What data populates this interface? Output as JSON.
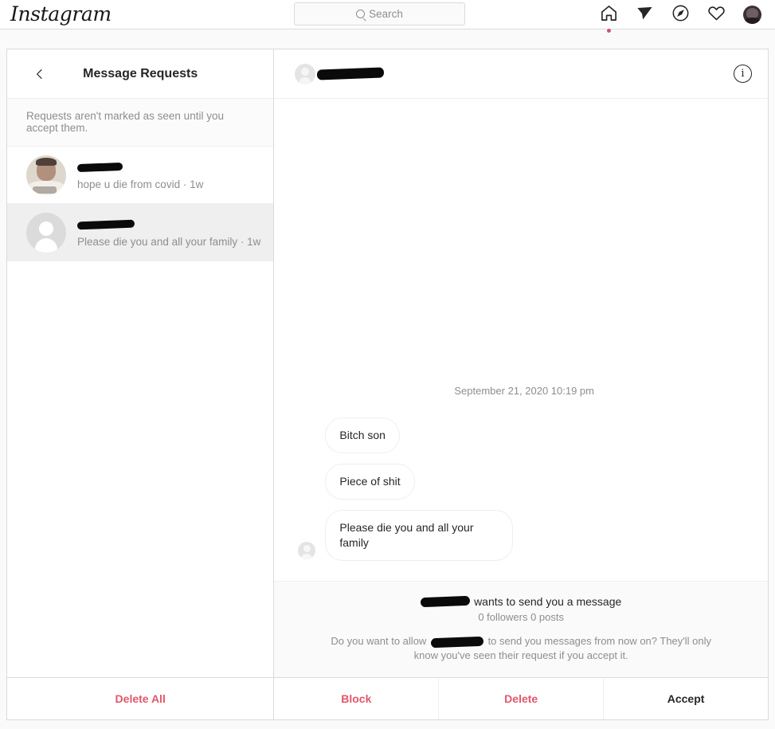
{
  "app": {
    "brand": "Instagram",
    "accent_red": "#e2576b",
    "text_primary": "#262626",
    "text_secondary": "#8e8e8e"
  },
  "topnav": {
    "search": {
      "placeholder": "Search",
      "value": "",
      "icon": "search-icon"
    },
    "icons": [
      {
        "name": "home-icon",
        "has_badge": true,
        "badge_color": "#c9566a"
      },
      {
        "name": "direct-paper-plane-icon",
        "has_badge": false
      },
      {
        "name": "explore-compass-icon",
        "has_badge": false
      },
      {
        "name": "activity-heart-icon",
        "has_badge": false
      },
      {
        "name": "profile-avatar",
        "has_badge": false
      }
    ]
  },
  "sidebar": {
    "back_icon": "chevron-left-icon",
    "title": "Message Requests",
    "notice": "Requests aren't marked as seen until you accept them.",
    "requests": [
      {
        "name_redacted": true,
        "name_bar_width": 57,
        "avatar_type": "photo",
        "preview": "hope u die from covid · 1w",
        "selected": false
      },
      {
        "name_redacted": true,
        "name_bar_width": 72,
        "avatar_type": "default",
        "preview": "Please die you and all your family · 1w",
        "selected": true
      }
    ],
    "delete_all_label": "Delete All"
  },
  "conversation": {
    "header": {
      "name_redacted": true,
      "name_bar_width": 84,
      "avatar_type": "default",
      "info_icon": "info-circle-icon",
      "info_glyph": "i"
    },
    "date_separator": "September 21, 2020 10:19 pm",
    "messages": [
      {
        "text": "Bitch son",
        "from": "them",
        "show_avatar": false
      },
      {
        "text": "Piece of shit",
        "from": "them",
        "show_avatar": false
      },
      {
        "text": "Please die you and all your family",
        "from": "them",
        "show_avatar": true
      }
    ],
    "request_footer": {
      "headline_suffix": "wants to send you a message",
      "headline_name_redacted": true,
      "headline_bar_width": 62,
      "stats": "0 followers 0 posts",
      "ask_prefix": "Do you want to allow",
      "ask_name_redacted": true,
      "ask_bar_width": 66,
      "ask_suffix": "to send you messages from now on? They'll only know you've seen their request if you accept it."
    },
    "actions": [
      {
        "label": "Block",
        "style": "red"
      },
      {
        "label": "Delete",
        "style": "red"
      },
      {
        "label": "Accept",
        "style": "dark"
      }
    ]
  }
}
